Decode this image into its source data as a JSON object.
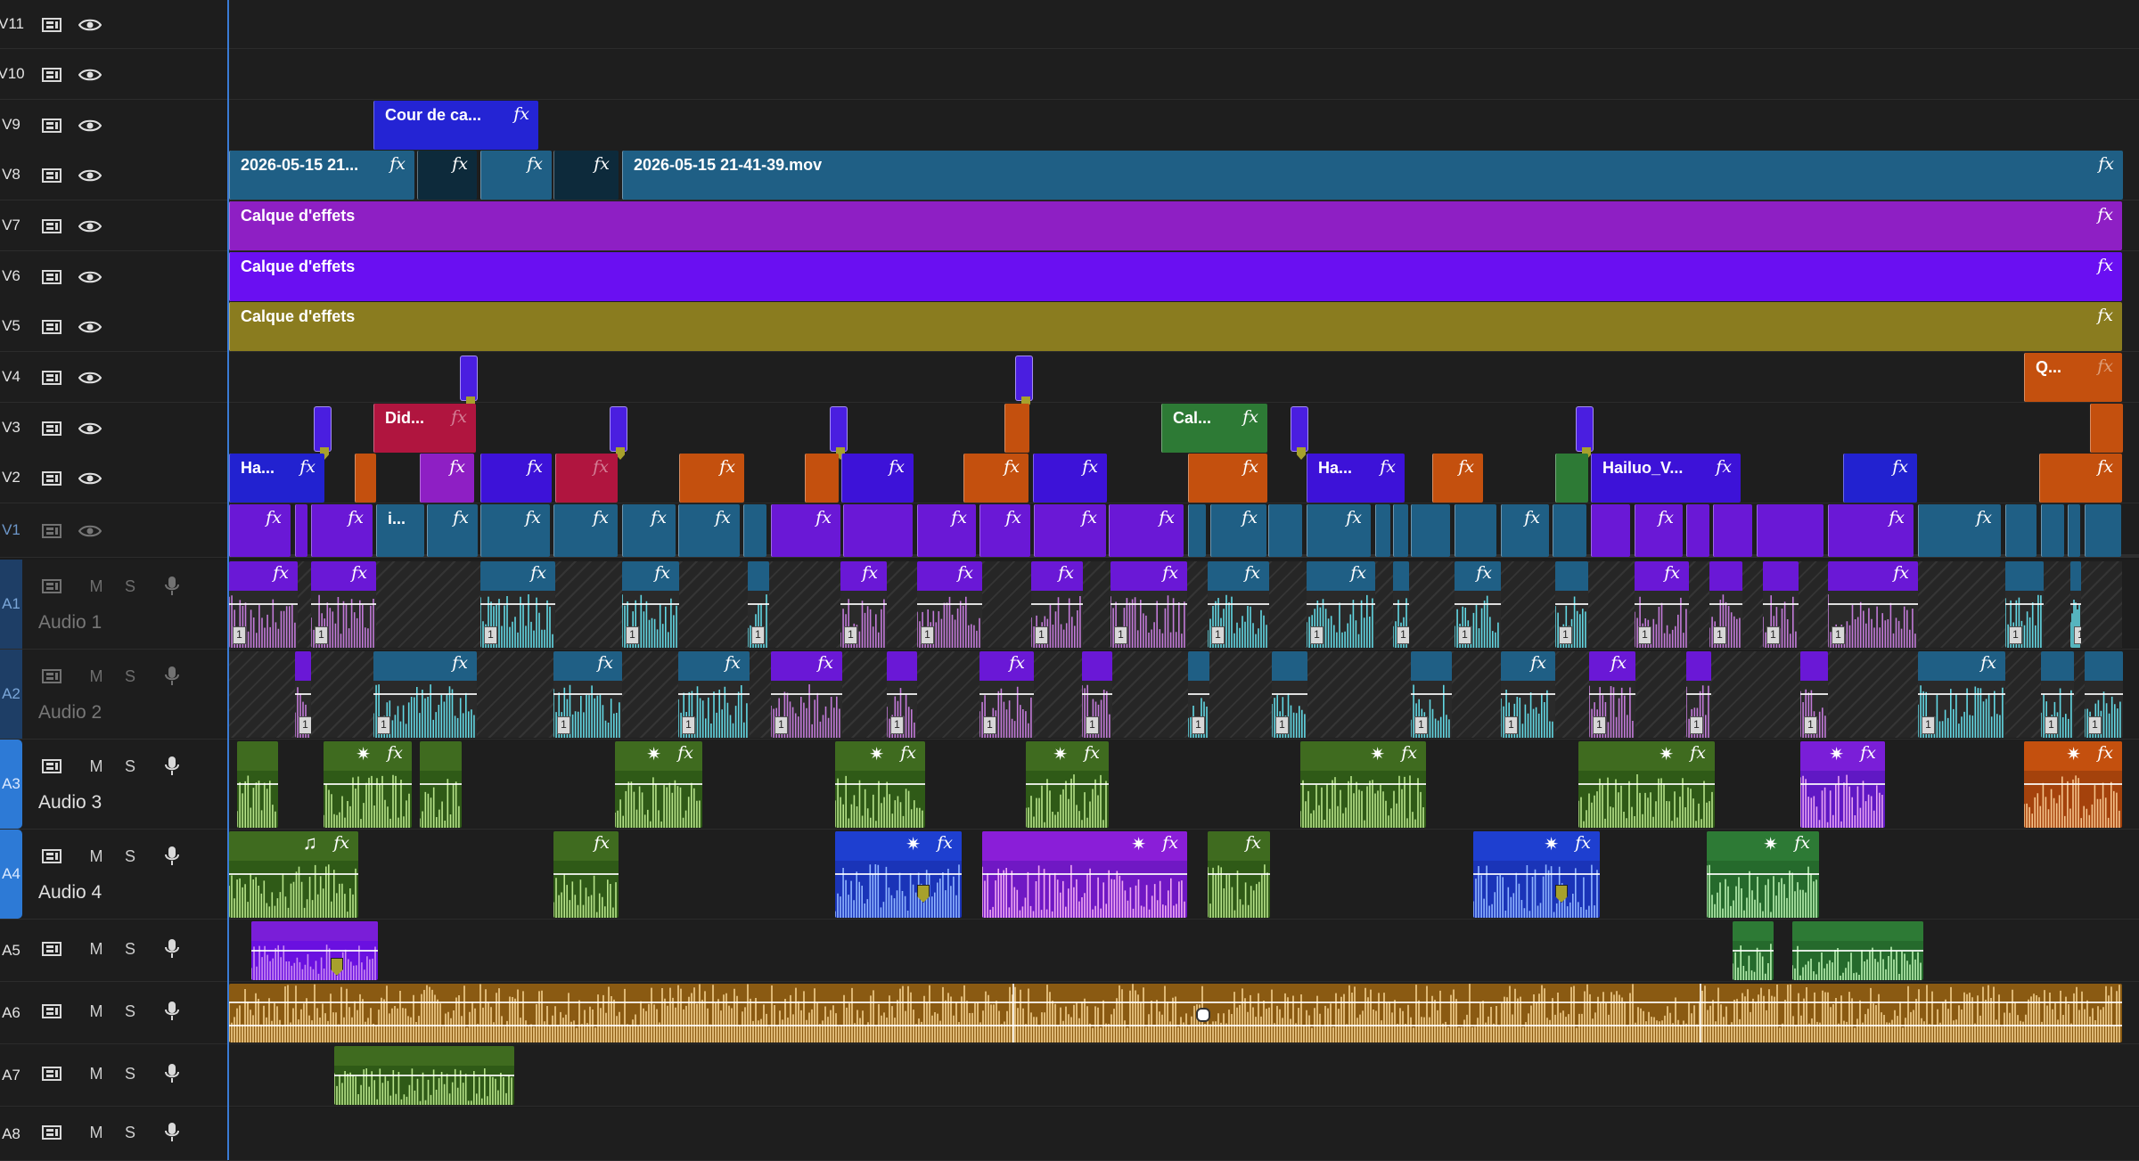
{
  "video_tracks": [
    {
      "id": "V11",
      "height": 0
    },
    {
      "id": "V10"
    },
    {
      "id": "V9"
    },
    {
      "id": "V8"
    },
    {
      "id": "V7"
    },
    {
      "id": "V6"
    },
    {
      "id": "V5"
    },
    {
      "id": "V4"
    },
    {
      "id": "V3"
    },
    {
      "id": "V2"
    },
    {
      "id": "V1"
    }
  ],
  "audio_tracks": [
    {
      "id": "A1",
      "name": "Audio 1"
    },
    {
      "id": "A2",
      "name": "Audio 2"
    },
    {
      "id": "A3",
      "name": "Audio 3"
    },
    {
      "id": "A4",
      "name": "Audio 4"
    },
    {
      "id": "A5",
      "name": ""
    },
    {
      "id": "A6",
      "name": ""
    },
    {
      "id": "A7",
      "name": ""
    },
    {
      "id": "A8",
      "name": ""
    }
  ],
  "buttons": {
    "mute": "M",
    "solo": "S"
  },
  "clip_labels": {
    "v9_cour": "Cour de ca...",
    "v8_first": "2026-05-15 21...",
    "v8_main": "2026-05-15 21-41-39.mov",
    "v7": "Calque d'effets",
    "v6": "Calque d'effets",
    "v5": "Calque d'effets",
    "v4_q": "Q...",
    "v3_did": "Did...",
    "v3_cal": "Cal...",
    "v2_ha1": "Ha...",
    "v2_ha2": "Ha...",
    "v2_hailuo": "Hailuo_V...",
    "v1_i": "i...",
    "fx": "fx",
    "clip_number": "1"
  },
  "colors": {
    "blue_clip": "#2424d4",
    "teal_clip": "#1f5f85",
    "purple_clip": "#8e1fc4",
    "violet_clip": "#6a0ff2",
    "olive_clip": "#8a7c1f",
    "orange_clip": "#c4500e",
    "crimson_clip": "#b0153f",
    "green_clip": "#2d7a35",
    "playhead": "#3a7bd5"
  },
  "icons": [
    "film-strip-icon",
    "eye-icon",
    "microphone-icon",
    "fx-badge-icon",
    "keyframe-icon",
    "music-note-icon",
    "star-effect-icon",
    "speaker-icon"
  ]
}
